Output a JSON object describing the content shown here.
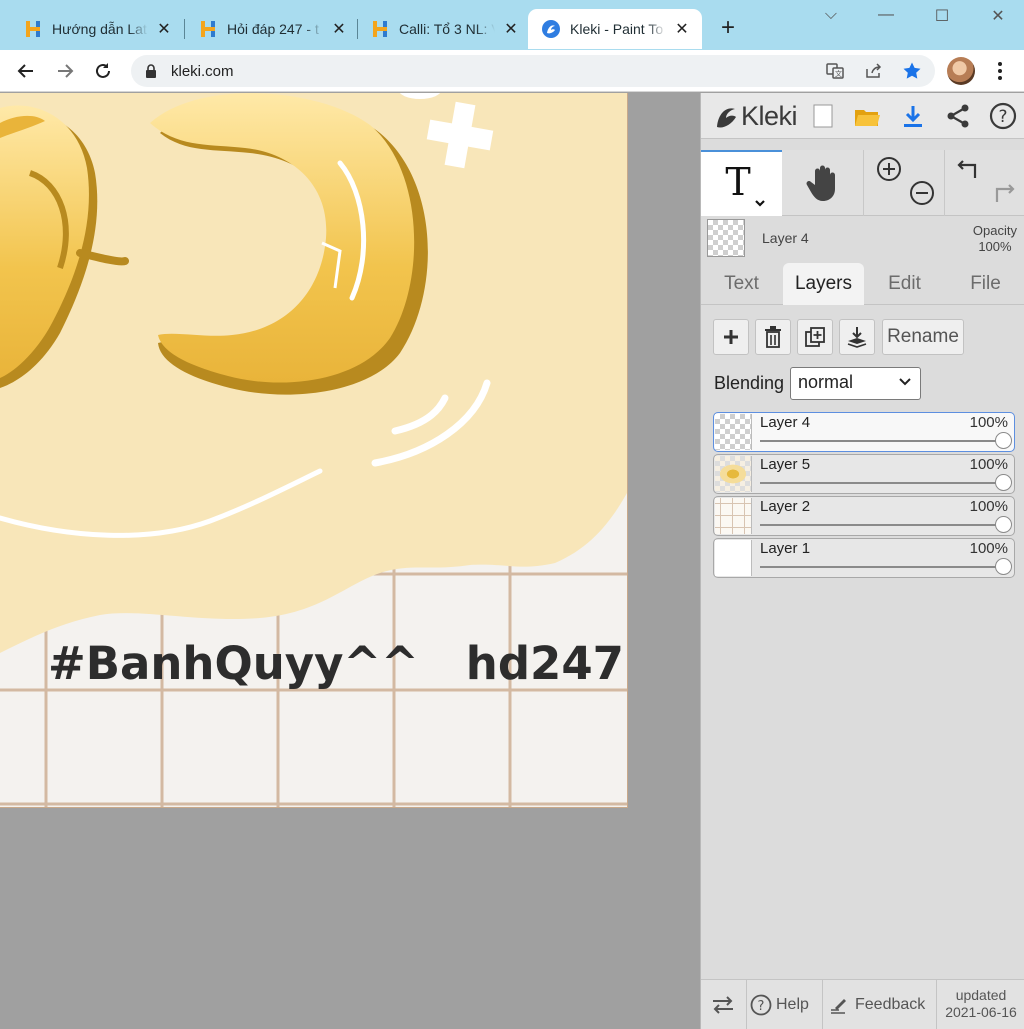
{
  "browser": {
    "tabs": [
      {
        "title": "Hướng dẫn Lat",
        "active": false
      },
      {
        "title": "Hỏi đáp 247 - t",
        "active": false
      },
      {
        "title": "Calli: Tổ 3 NL: V",
        "active": false
      },
      {
        "title": "Kleki - Paint To",
        "active": true
      }
    ],
    "new_tab": "+",
    "window_controls": {
      "dropdown": "⌵",
      "minimize": "—",
      "maximize": "☐",
      "close": "✕"
    },
    "url": "kleki.com",
    "colors": {
      "tabbar": "#a9dcef",
      "star": "#1a73e8"
    }
  },
  "canvas": {
    "caption": "#BanhQuyy^^   hd247",
    "colors": {
      "cream": "#f8e6b9",
      "gold": "#e8b93c",
      "dark_gold": "#b88a1f",
      "grid_line": "#d2b7a0",
      "background": "#a0a0a0"
    }
  },
  "panel": {
    "brand": "Kleki",
    "active_layer": {
      "name": "Layer 4",
      "opacity_label": "Opacity",
      "opacity_value": "100%"
    },
    "tabs": [
      {
        "label": "Text",
        "active": false
      },
      {
        "label": "Layers",
        "active": true
      },
      {
        "label": "Edit",
        "active": false
      },
      {
        "label": "File",
        "active": false
      }
    ],
    "rename_label": "Rename",
    "blending_label": "Blending",
    "blending_value": "normal",
    "layers": [
      {
        "name": "Layer 4",
        "opacity": "100%",
        "opacity_fraction": 1.0,
        "selected": true,
        "thumb": "checker"
      },
      {
        "name": "Layer 5",
        "opacity": "100%",
        "opacity_fraction": 1.0,
        "selected": false,
        "thumb": "cookie"
      },
      {
        "name": "Layer 2",
        "opacity": "100%",
        "opacity_fraction": 1.0,
        "selected": false,
        "thumb": "grid"
      },
      {
        "name": "Layer 1",
        "opacity": "100%",
        "opacity_fraction": 1.0,
        "selected": false,
        "thumb": "white"
      }
    ],
    "bottom": {
      "help": "Help",
      "feedback": "Feedback",
      "updated_label": "updated",
      "updated_date": "2021-06-16"
    },
    "colors": {
      "accent": "#4a90d9",
      "download": "#1a73e8",
      "folder": "#f2b21b"
    }
  }
}
